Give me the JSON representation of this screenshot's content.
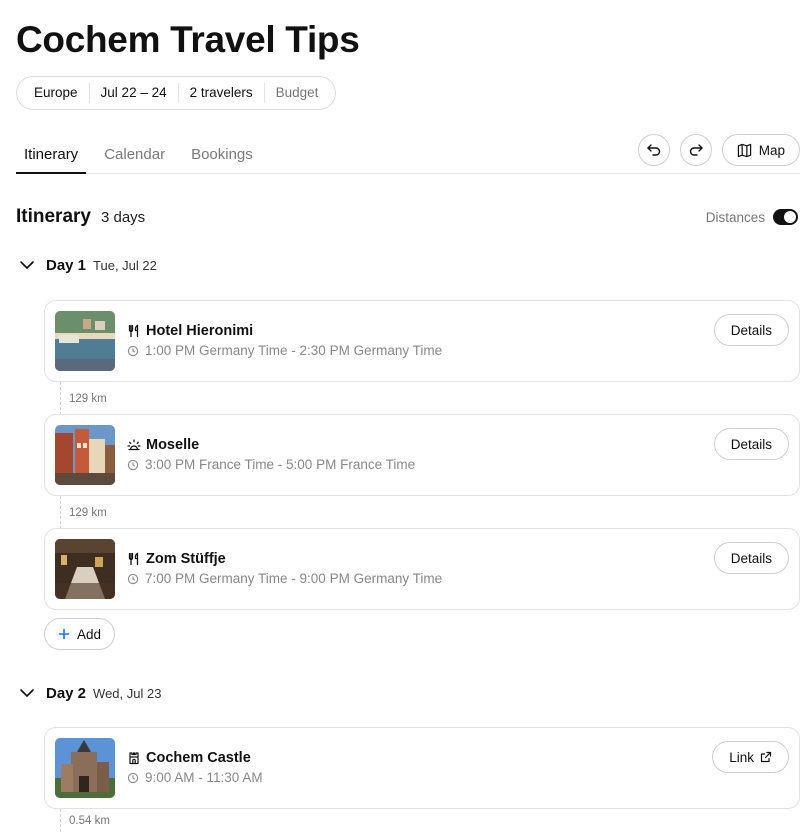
{
  "title": "Cochem Travel Tips",
  "chips": [
    "Europe",
    "Jul 22 – 24",
    "2 travelers",
    "Budget"
  ],
  "tabs": [
    {
      "label": "Itinerary",
      "active": true
    },
    {
      "label": "Calendar",
      "active": false
    },
    {
      "label": "Bookings",
      "active": false
    }
  ],
  "toolbar": {
    "undo_icon": "undo-icon",
    "redo_icon": "redo-icon",
    "map_label": "Map",
    "map_icon": "map-icon"
  },
  "itinerary": {
    "title": "Itinerary",
    "count": "3 days",
    "distances_label": "Distances",
    "distances_on": true
  },
  "days": [
    {
      "label": "Day 1",
      "date": "Tue, Jul 22",
      "items": [
        {
          "name": "Hotel Hieronimi",
          "type_icon": "restaurant-icon",
          "time": "1:00 PM Germany Time - 2:30 PM Germany Time",
          "action": "Details"
        },
        {
          "name": "Moselle",
          "type_icon": "sightseeing-icon",
          "time": "3:00 PM France Time - 5:00 PM France Time",
          "action": "Details"
        },
        {
          "name": "Zom Stüffje",
          "type_icon": "restaurant-icon",
          "time": "7:00 PM Germany Time - 9:00 PM Germany Time",
          "action": "Details"
        }
      ],
      "distances": [
        "129 km",
        "129 km"
      ],
      "add_label": "Add"
    },
    {
      "label": "Day 2",
      "date": "Wed, Jul 23",
      "items": [
        {
          "name": "Cochem Castle",
          "type_icon": "castle-icon",
          "time": "9:00 AM - 11:30 AM",
          "action": "Link"
        }
      ],
      "distances": [
        "0.54 km"
      ]
    }
  ],
  "colors": {
    "text": "#111111",
    "muted": "#888888",
    "border": "#e2e2e2",
    "accent": "#1a73e8"
  }
}
